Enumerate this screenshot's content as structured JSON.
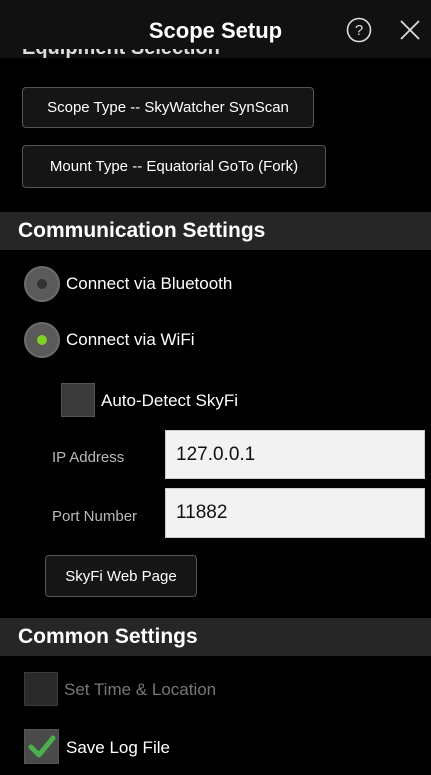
{
  "header": {
    "title": "Scope Setup",
    "help_icon": "help-circle-icon",
    "close_icon": "close-icon"
  },
  "equipment": {
    "heading": "Equipment Selection",
    "scope_type_label": "Scope Type -- SkyWatcher SynScan",
    "mount_type_label": "Mount Type -- Equatorial GoTo (Fork)"
  },
  "communication": {
    "heading": "Communication Settings",
    "bluetooth_label": "Connect via Bluetooth",
    "bluetooth_selected": false,
    "wifi_label": "Connect via WiFi",
    "wifi_selected": true,
    "auto_detect_label": "Auto-Detect SkyFi",
    "auto_detect_checked": false,
    "ip_label": "IP Address",
    "ip_value": "127.0.0.1",
    "port_label": "Port Number",
    "port_value": "11882",
    "web_page_label": "SkyFi Web Page"
  },
  "common": {
    "heading": "Common Settings",
    "set_time_label": "Set Time & Location",
    "set_time_checked": false,
    "save_log_label": "Save Log File",
    "save_log_checked": true
  },
  "colors": {
    "accent_green": "#7ed321",
    "check_green": "#4caf50",
    "section_bg": "#262626"
  }
}
